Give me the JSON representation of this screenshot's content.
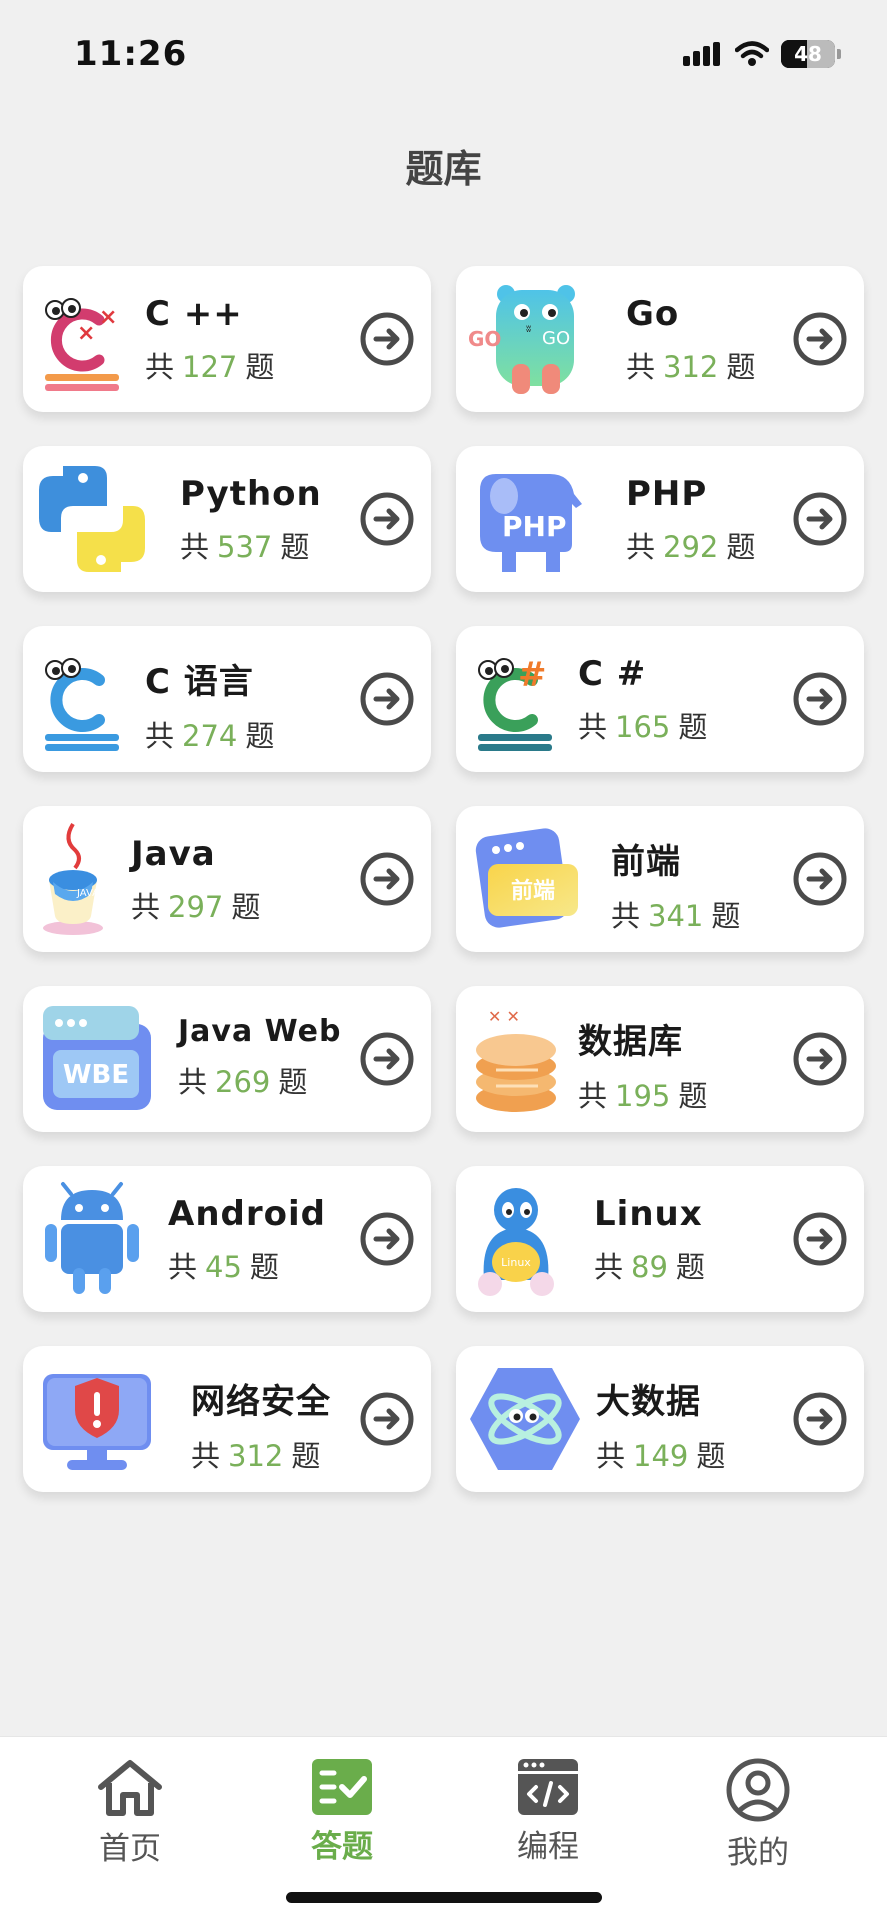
{
  "status_bar": {
    "time": "11:26",
    "battery": "48",
    "battery_level": 0.48
  },
  "page": {
    "title": "题库"
  },
  "count_prefix": "共",
  "count_suffix": "题",
  "categories": [
    {
      "name": "C ++",
      "count": "127",
      "icon": "cpp-icon"
    },
    {
      "name": "Go",
      "count": "312",
      "icon": "go-gopher-icon"
    },
    {
      "name": "Python",
      "count": "537",
      "icon": "python-icon"
    },
    {
      "name": "PHP",
      "count": "292",
      "icon": "php-elephant-icon"
    },
    {
      "name": "C 语言",
      "count": "274",
      "icon": "c-language-icon"
    },
    {
      "name": "C #",
      "count": "165",
      "icon": "csharp-icon"
    },
    {
      "name": "Java",
      "count": "297",
      "icon": "java-cup-icon"
    },
    {
      "name": "前端",
      "count": "341",
      "icon": "frontend-icon",
      "icon_text": "前端"
    },
    {
      "name": "Java Web",
      "count": "269",
      "icon": "java-web-icon",
      "icon_text": "WBE"
    },
    {
      "name": "数据库",
      "count": "195",
      "icon": "database-icon"
    },
    {
      "name": "Android",
      "count": "45",
      "icon": "android-icon"
    },
    {
      "name": "Linux",
      "count": "89",
      "icon": "linux-penguin-icon",
      "icon_text": "Linux"
    },
    {
      "name": "网络安全",
      "count": "312",
      "icon": "security-monitor-icon"
    },
    {
      "name": "大数据",
      "count": "149",
      "icon": "big-data-icon"
    }
  ],
  "tabbar": {
    "active_color": "#6aad4b",
    "tabs": [
      {
        "label": "首页",
        "icon": "home-icon"
      },
      {
        "label": "答题",
        "icon": "quiz-icon"
      },
      {
        "label": "编程",
        "icon": "code-icon"
      },
      {
        "label": "我的",
        "icon": "profile-icon"
      }
    ]
  }
}
